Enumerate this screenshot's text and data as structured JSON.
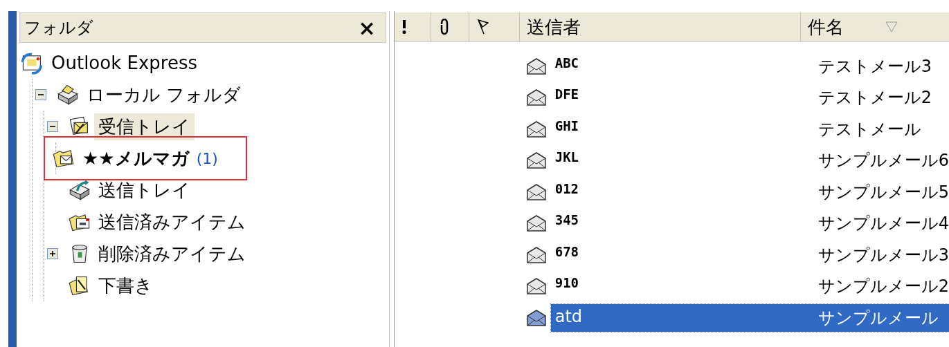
{
  "folder_pane": {
    "title": "フォルダ",
    "close": "×",
    "tree": [
      {
        "label": "Outlook Express",
        "kind": "outlook",
        "selected": false,
        "children": [
          {
            "label": "ローカル フォルダ",
            "kind": "local",
            "expanded": true,
            "selected": false,
            "children": [
              {
                "label": "受信トレイ",
                "kind": "inbox",
                "expanded": true,
                "selected": true,
                "children": [
                  {
                    "label": "★★メルマガ",
                    "count": "(1)",
                    "kind": "folder",
                    "selected": false,
                    "annotated": true
                  }
                ]
              },
              {
                "label": "送信トレイ",
                "kind": "outbox",
                "selected": false
              },
              {
                "label": "送信済みアイテム",
                "kind": "sent",
                "selected": false
              },
              {
                "label": "削除済みアイテム",
                "kind": "trash",
                "expanded": false,
                "selected": false
              },
              {
                "label": "下書き",
                "kind": "drafts",
                "selected": false
              }
            ]
          }
        ]
      }
    ]
  },
  "message_list": {
    "columns": [
      {
        "kind": "priority"
      },
      {
        "kind": "attachment"
      },
      {
        "kind": "flag"
      },
      {
        "kind": "text",
        "label": "送信者",
        "sorted": false
      },
      {
        "kind": "text",
        "label": "件名",
        "sorted": true
      }
    ],
    "rows": [
      {
        "sender": "ABC",
        "subject": "テストメール3",
        "selected": false
      },
      {
        "sender": "DFE",
        "subject": "テストメール2",
        "selected": false
      },
      {
        "sender": "GHI",
        "subject": "テストメール",
        "selected": false
      },
      {
        "sender": "JKL",
        "subject": "サンプルメール6",
        "selected": false
      },
      {
        "sender": "012",
        "subject": "サンプルメール5",
        "selected": false
      },
      {
        "sender": "345",
        "subject": "サンプルメール4",
        "selected": false
      },
      {
        "sender": "678",
        "subject": "サンプルメール3",
        "selected": false
      },
      {
        "sender": "910",
        "subject": "サンプルメール2",
        "selected": false
      },
      {
        "sender": "atd",
        "subject": "サンプルメール",
        "selected": true
      }
    ]
  }
}
